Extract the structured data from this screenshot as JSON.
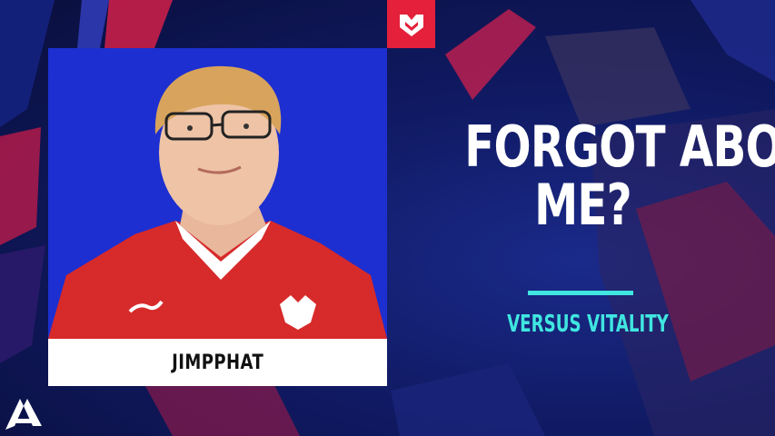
{
  "player": {
    "name": "JIMPPHAT"
  },
  "headline": {
    "line1": "FORGOT ABOUT",
    "line2": "ME?"
  },
  "subline": "VERSUS VITALITY",
  "colors": {
    "background": "#0c1347",
    "panel": "#1d2fd0",
    "team_red": "#e4203a",
    "accent_cyan": "#40e6e0",
    "text": "#ffffff"
  },
  "icons": {
    "team_logo": "mousesports-logo-icon",
    "event_logo": "blast-logo-icon"
  }
}
